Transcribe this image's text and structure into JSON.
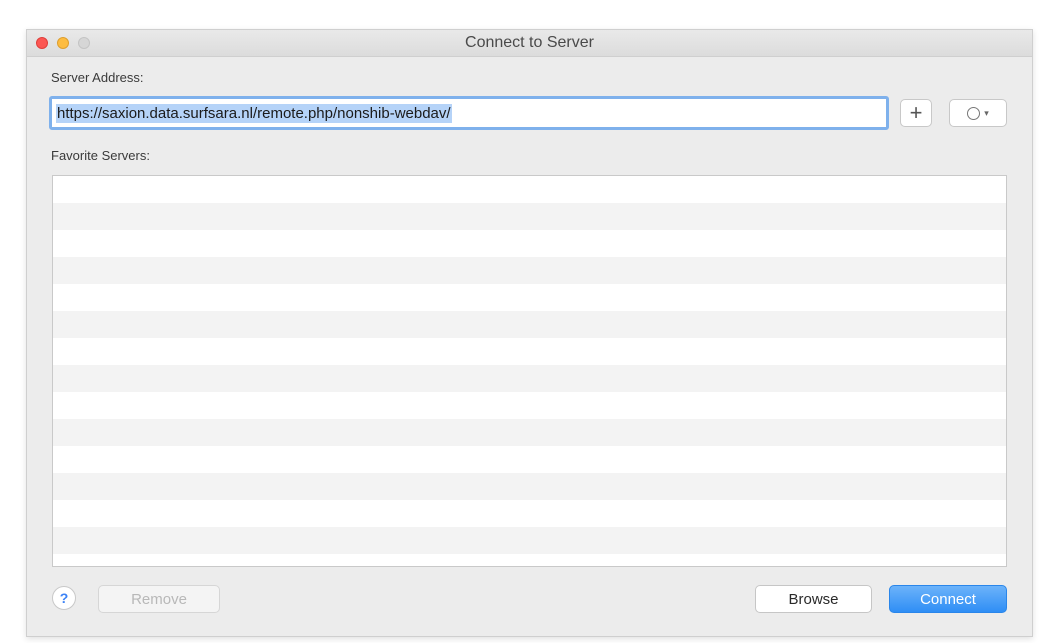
{
  "window": {
    "title": "Connect to Server"
  },
  "server_address": {
    "label": "Server Address:",
    "value": "https://saxion.data.surfsara.nl/remote.php/nonshib-webdav/"
  },
  "toolbar": {
    "add_label": "+",
    "recent_icon": "clock-icon",
    "recent_caret": "▾"
  },
  "favorites": {
    "label": "Favorite Servers:",
    "items": []
  },
  "footer": {
    "help_label": "?",
    "remove_label": "Remove",
    "browse_label": "Browse",
    "connect_label": "Connect"
  },
  "colors": {
    "accent": "#2f8ef5",
    "selection": "#b5d3f8",
    "close": "#fc5753",
    "minimize": "#fdbc40",
    "zoom_disabled": "#d6d6d6"
  }
}
